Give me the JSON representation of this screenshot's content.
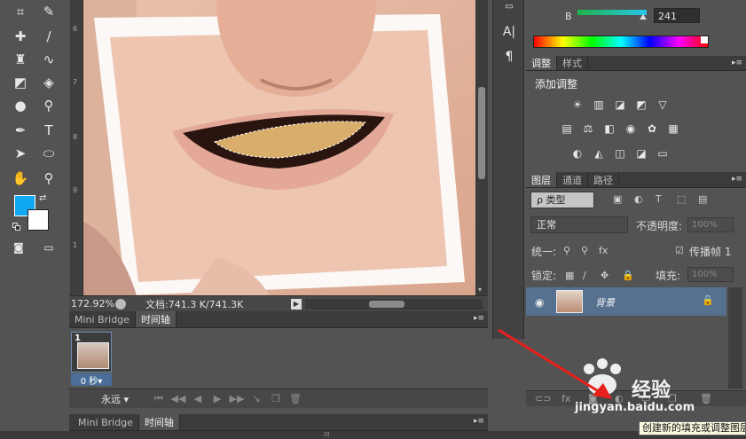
{
  "canvas": {
    "zoom": "172.92%",
    "doc_size": "文档:741.3 K/741.3K",
    "ruler_marks": [
      "6",
      "7",
      "8",
      "9",
      "1"
    ]
  },
  "timeline": {
    "tabs": [
      "Mini Bridge",
      "时间轴"
    ],
    "frame_number": "1",
    "frame_delay": "0 秒▾",
    "loop_option": "永远 ▾",
    "controls": [
      "⏮",
      "◀◀",
      "◀",
      "▶",
      "▶▶"
    ]
  },
  "bottom_tabs": [
    "Mini Bridge",
    "时间轴"
  ],
  "color_panel": {
    "channel_label": "B",
    "channel_value": "241",
    "channel_fraction": 0.945
  },
  "adjustments": {
    "tabs": [
      "调整",
      "样式"
    ],
    "title": "添加调整"
  },
  "layers": {
    "tabs": [
      "图层",
      "通道",
      "路径"
    ],
    "filter_kind": "ρ 类型",
    "blend_mode": "正常",
    "opacity_label": "不透明度:",
    "opacity_value": "100%",
    "unify_label": "统一:",
    "propagate_label": "传播帧 1",
    "lock_label": "锁定:",
    "fill_label": "填充:",
    "fill_value": "100%",
    "layer_name": "背景"
  },
  "tooltip": "创建新的填充或调整图层",
  "watermark": {
    "brand": "经验",
    "url": "jingyan.baidu.com"
  },
  "colors": {
    "foreground": "#10a8f0",
    "background": "#ffffff",
    "selection_accent": "#56718f"
  },
  "icons": [
    "crop-icon",
    "eyedropper-icon",
    "heal-icon",
    "brush-icon",
    "stamp-icon",
    "history-brush-icon",
    "eraser-icon",
    "bucket-icon",
    "blur-icon",
    "dodge-icon",
    "pen-icon",
    "type-icon",
    "path-select-icon",
    "ellipse-icon",
    "hand-icon",
    "zoom-icon",
    "eye-icon",
    "lock-icon"
  ]
}
